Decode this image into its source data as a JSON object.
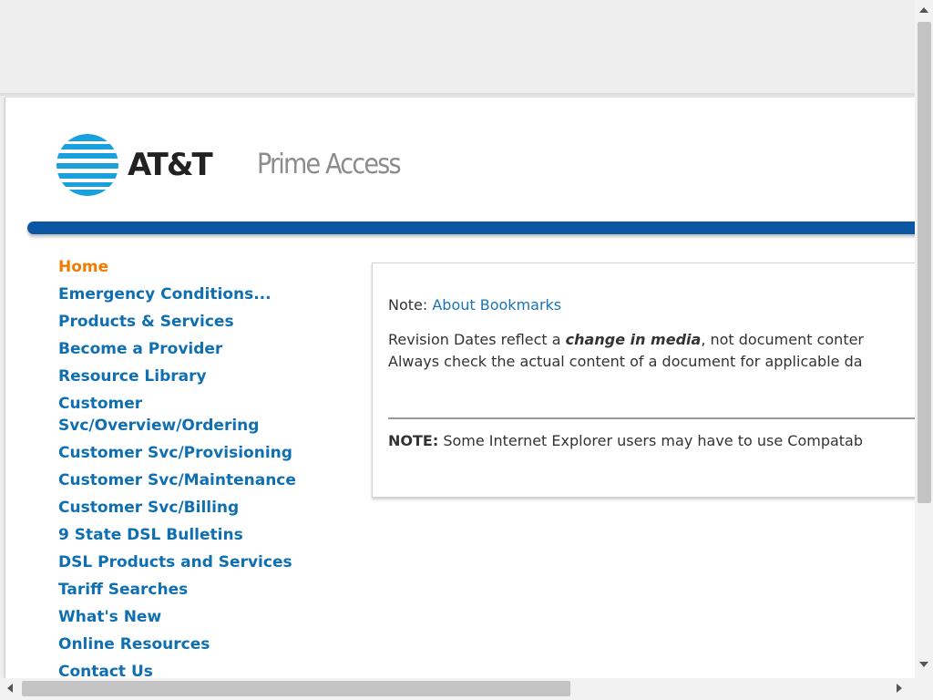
{
  "header": {
    "brand": "AT&T",
    "product": "Prime Access"
  },
  "colors": {
    "brand_blue": "#0b57a4",
    "link_blue": "#0f6fb0",
    "active_orange": "#f07c00",
    "logo_blue": "#1aa0dc"
  },
  "nav": {
    "items": [
      {
        "label": "Home",
        "active": true
      },
      {
        "label": "Emergency Conditions..."
      },
      {
        "label": "Products & Services"
      },
      {
        "label": "Become a Provider"
      },
      {
        "label": "Resource Library"
      },
      {
        "label": "Customer Svc/Overview/Ordering"
      },
      {
        "label": "Customer Svc/Provisioning"
      },
      {
        "label": "Customer Svc/Maintenance"
      },
      {
        "label": "Customer Svc/Billing"
      },
      {
        "label": "9 State DSL Bulletins"
      },
      {
        "label": "DSL Products and Services"
      },
      {
        "label": "Tariff Searches"
      },
      {
        "label": "What's New"
      },
      {
        "label": "Online Resources"
      },
      {
        "label": "Contact Us"
      }
    ]
  },
  "notice": {
    "note_prefix": "Note:",
    "bookmarks_link": "About Bookmarks",
    "revision_prefix": "Revision Dates reflect a",
    "revision_emphasis": "change in media",
    "revision_suffix": ", not document conter",
    "revision_line2": "Always check the actual content of a document for applicable da",
    "ie_label": "NOTE:",
    "ie_text": "Some Internet Explorer users may have to use Compatab"
  },
  "icons": {
    "logo": "att-globe-icon",
    "scroll_up": "arrow-up-icon",
    "scroll_down": "arrow-down-icon",
    "scroll_left": "arrow-left-icon",
    "scroll_right": "arrow-right-icon"
  }
}
